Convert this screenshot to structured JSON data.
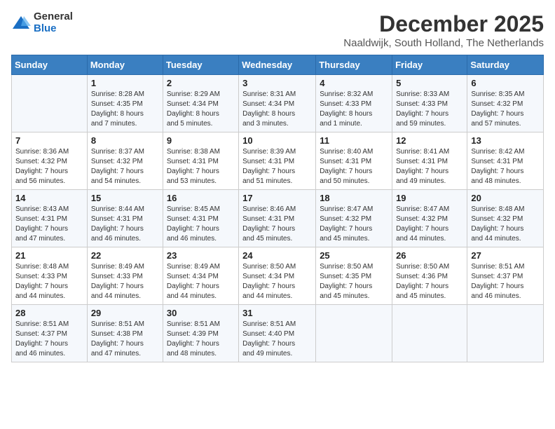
{
  "logo": {
    "general": "General",
    "blue": "Blue"
  },
  "title": "December 2025",
  "location": "Naaldwijk, South Holland, The Netherlands",
  "days_of_week": [
    "Sunday",
    "Monday",
    "Tuesday",
    "Wednesday",
    "Thursday",
    "Friday",
    "Saturday"
  ],
  "weeks": [
    [
      {
        "day": "",
        "info": ""
      },
      {
        "day": "1",
        "info": "Sunrise: 8:28 AM\nSunset: 4:35 PM\nDaylight: 8 hours\nand 7 minutes."
      },
      {
        "day": "2",
        "info": "Sunrise: 8:29 AM\nSunset: 4:34 PM\nDaylight: 8 hours\nand 5 minutes."
      },
      {
        "day": "3",
        "info": "Sunrise: 8:31 AM\nSunset: 4:34 PM\nDaylight: 8 hours\nand 3 minutes."
      },
      {
        "day": "4",
        "info": "Sunrise: 8:32 AM\nSunset: 4:33 PM\nDaylight: 8 hours\nand 1 minute."
      },
      {
        "day": "5",
        "info": "Sunrise: 8:33 AM\nSunset: 4:33 PM\nDaylight: 7 hours\nand 59 minutes."
      },
      {
        "day": "6",
        "info": "Sunrise: 8:35 AM\nSunset: 4:32 PM\nDaylight: 7 hours\nand 57 minutes."
      }
    ],
    [
      {
        "day": "7",
        "info": "Sunrise: 8:36 AM\nSunset: 4:32 PM\nDaylight: 7 hours\nand 56 minutes."
      },
      {
        "day": "8",
        "info": "Sunrise: 8:37 AM\nSunset: 4:32 PM\nDaylight: 7 hours\nand 54 minutes."
      },
      {
        "day": "9",
        "info": "Sunrise: 8:38 AM\nSunset: 4:31 PM\nDaylight: 7 hours\nand 53 minutes."
      },
      {
        "day": "10",
        "info": "Sunrise: 8:39 AM\nSunset: 4:31 PM\nDaylight: 7 hours\nand 51 minutes."
      },
      {
        "day": "11",
        "info": "Sunrise: 8:40 AM\nSunset: 4:31 PM\nDaylight: 7 hours\nand 50 minutes."
      },
      {
        "day": "12",
        "info": "Sunrise: 8:41 AM\nSunset: 4:31 PM\nDaylight: 7 hours\nand 49 minutes."
      },
      {
        "day": "13",
        "info": "Sunrise: 8:42 AM\nSunset: 4:31 PM\nDaylight: 7 hours\nand 48 minutes."
      }
    ],
    [
      {
        "day": "14",
        "info": "Sunrise: 8:43 AM\nSunset: 4:31 PM\nDaylight: 7 hours\nand 47 minutes."
      },
      {
        "day": "15",
        "info": "Sunrise: 8:44 AM\nSunset: 4:31 PM\nDaylight: 7 hours\nand 46 minutes."
      },
      {
        "day": "16",
        "info": "Sunrise: 8:45 AM\nSunset: 4:31 PM\nDaylight: 7 hours\nand 46 minutes."
      },
      {
        "day": "17",
        "info": "Sunrise: 8:46 AM\nSunset: 4:31 PM\nDaylight: 7 hours\nand 45 minutes."
      },
      {
        "day": "18",
        "info": "Sunrise: 8:47 AM\nSunset: 4:32 PM\nDaylight: 7 hours\nand 45 minutes."
      },
      {
        "day": "19",
        "info": "Sunrise: 8:47 AM\nSunset: 4:32 PM\nDaylight: 7 hours\nand 44 minutes."
      },
      {
        "day": "20",
        "info": "Sunrise: 8:48 AM\nSunset: 4:32 PM\nDaylight: 7 hours\nand 44 minutes."
      }
    ],
    [
      {
        "day": "21",
        "info": "Sunrise: 8:48 AM\nSunset: 4:33 PM\nDaylight: 7 hours\nand 44 minutes."
      },
      {
        "day": "22",
        "info": "Sunrise: 8:49 AM\nSunset: 4:33 PM\nDaylight: 7 hours\nand 44 minutes."
      },
      {
        "day": "23",
        "info": "Sunrise: 8:49 AM\nSunset: 4:34 PM\nDaylight: 7 hours\nand 44 minutes."
      },
      {
        "day": "24",
        "info": "Sunrise: 8:50 AM\nSunset: 4:34 PM\nDaylight: 7 hours\nand 44 minutes."
      },
      {
        "day": "25",
        "info": "Sunrise: 8:50 AM\nSunset: 4:35 PM\nDaylight: 7 hours\nand 45 minutes."
      },
      {
        "day": "26",
        "info": "Sunrise: 8:50 AM\nSunset: 4:36 PM\nDaylight: 7 hours\nand 45 minutes."
      },
      {
        "day": "27",
        "info": "Sunrise: 8:51 AM\nSunset: 4:37 PM\nDaylight: 7 hours\nand 46 minutes."
      }
    ],
    [
      {
        "day": "28",
        "info": "Sunrise: 8:51 AM\nSunset: 4:37 PM\nDaylight: 7 hours\nand 46 minutes."
      },
      {
        "day": "29",
        "info": "Sunrise: 8:51 AM\nSunset: 4:38 PM\nDaylight: 7 hours\nand 47 minutes."
      },
      {
        "day": "30",
        "info": "Sunrise: 8:51 AM\nSunset: 4:39 PM\nDaylight: 7 hours\nand 48 minutes."
      },
      {
        "day": "31",
        "info": "Sunrise: 8:51 AM\nSunset: 4:40 PM\nDaylight: 7 hours\nand 49 minutes."
      },
      {
        "day": "",
        "info": ""
      },
      {
        "day": "",
        "info": ""
      },
      {
        "day": "",
        "info": ""
      }
    ]
  ]
}
